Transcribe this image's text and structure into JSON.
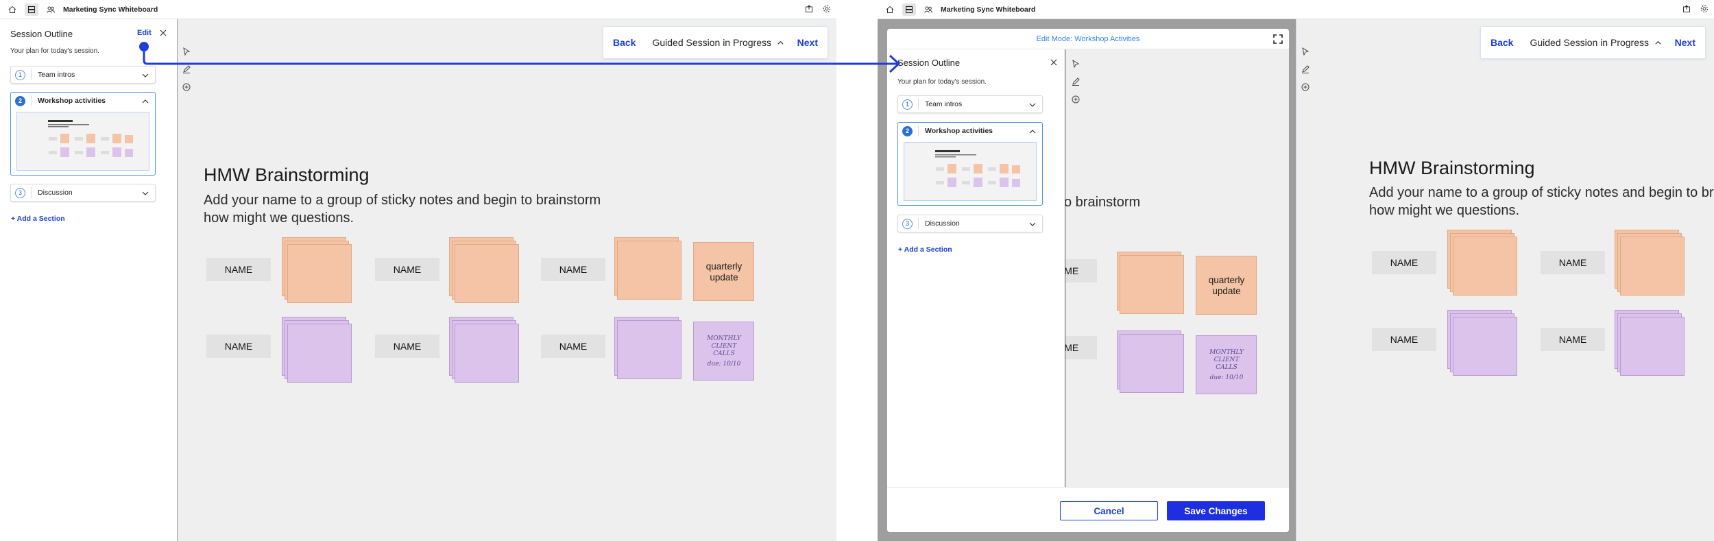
{
  "app": {
    "title": "Marketing Sync Whiteboard"
  },
  "outline": {
    "title": "Session Outline",
    "subtitle": "Your plan for today's session.",
    "edit_label": "Edit",
    "add_section_label": "+ Add a Section",
    "sections": [
      {
        "number": "1",
        "label": "Team intros"
      },
      {
        "number": "2",
        "label": "Workshop activities"
      },
      {
        "number": "3",
        "label": "Discussion"
      }
    ]
  },
  "guide": {
    "back_label": "Back",
    "status": "Guided Session in Progress",
    "next_label": "Next"
  },
  "board": {
    "title": "HMW Brainstorming",
    "desc_line1": "Add your name to a group of sticky notes and begin to brainstorm",
    "desc_line2": "how might we questions.",
    "name_label": "NAME",
    "note_update": "quarterly update",
    "note_hand_1": "MONTHLY",
    "note_hand_2": "CLIENT",
    "note_hand_3": "CALLS",
    "note_hand_4": "due: 10/10",
    "partial_desc": "o brainstorm",
    "partial_name": "NAME"
  },
  "modal": {
    "title": "Edit Mode: Workshop Activities",
    "cancel_label": "Cancel",
    "save_label": "Save Changes"
  },
  "colors": {
    "accent": "#1a3fd6",
    "sticky_orange": "#f5c4a6",
    "sticky_purple": "#dcc3ec",
    "connector": "#1f3ddb"
  }
}
